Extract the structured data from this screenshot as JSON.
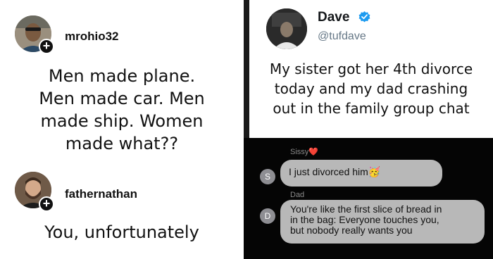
{
  "left": {
    "posts": [
      {
        "username": "mrohio32",
        "text_lines": [
          "Men made plane.",
          "Men made car. Men",
          "made ship. Women",
          "made what??"
        ]
      },
      {
        "username": "fathernathan",
        "text_lines": [
          "You, unfortunately"
        ]
      }
    ]
  },
  "tweet": {
    "name": "Dave",
    "handle": "@tufdave",
    "text_lines": [
      "My sister got her 4th divorce",
      "today and my dad crashing",
      "out in the family group chat"
    ]
  },
  "chat": {
    "messages": [
      {
        "sender": "Sissy❤️",
        "avatar_letter": "S",
        "text_lines": [
          "I just divorced him🥳"
        ]
      },
      {
        "sender": "Dad",
        "avatar_letter": "D",
        "text_lines": [
          "You're like the first slice of bread in",
          "in the bag: Everyone touches you,",
          "but nobody really wants you"
        ]
      }
    ]
  },
  "colors": {
    "verified": "#1d9bf0",
    "bubble": "#b8b8b8",
    "chat_bg": "#050505"
  }
}
